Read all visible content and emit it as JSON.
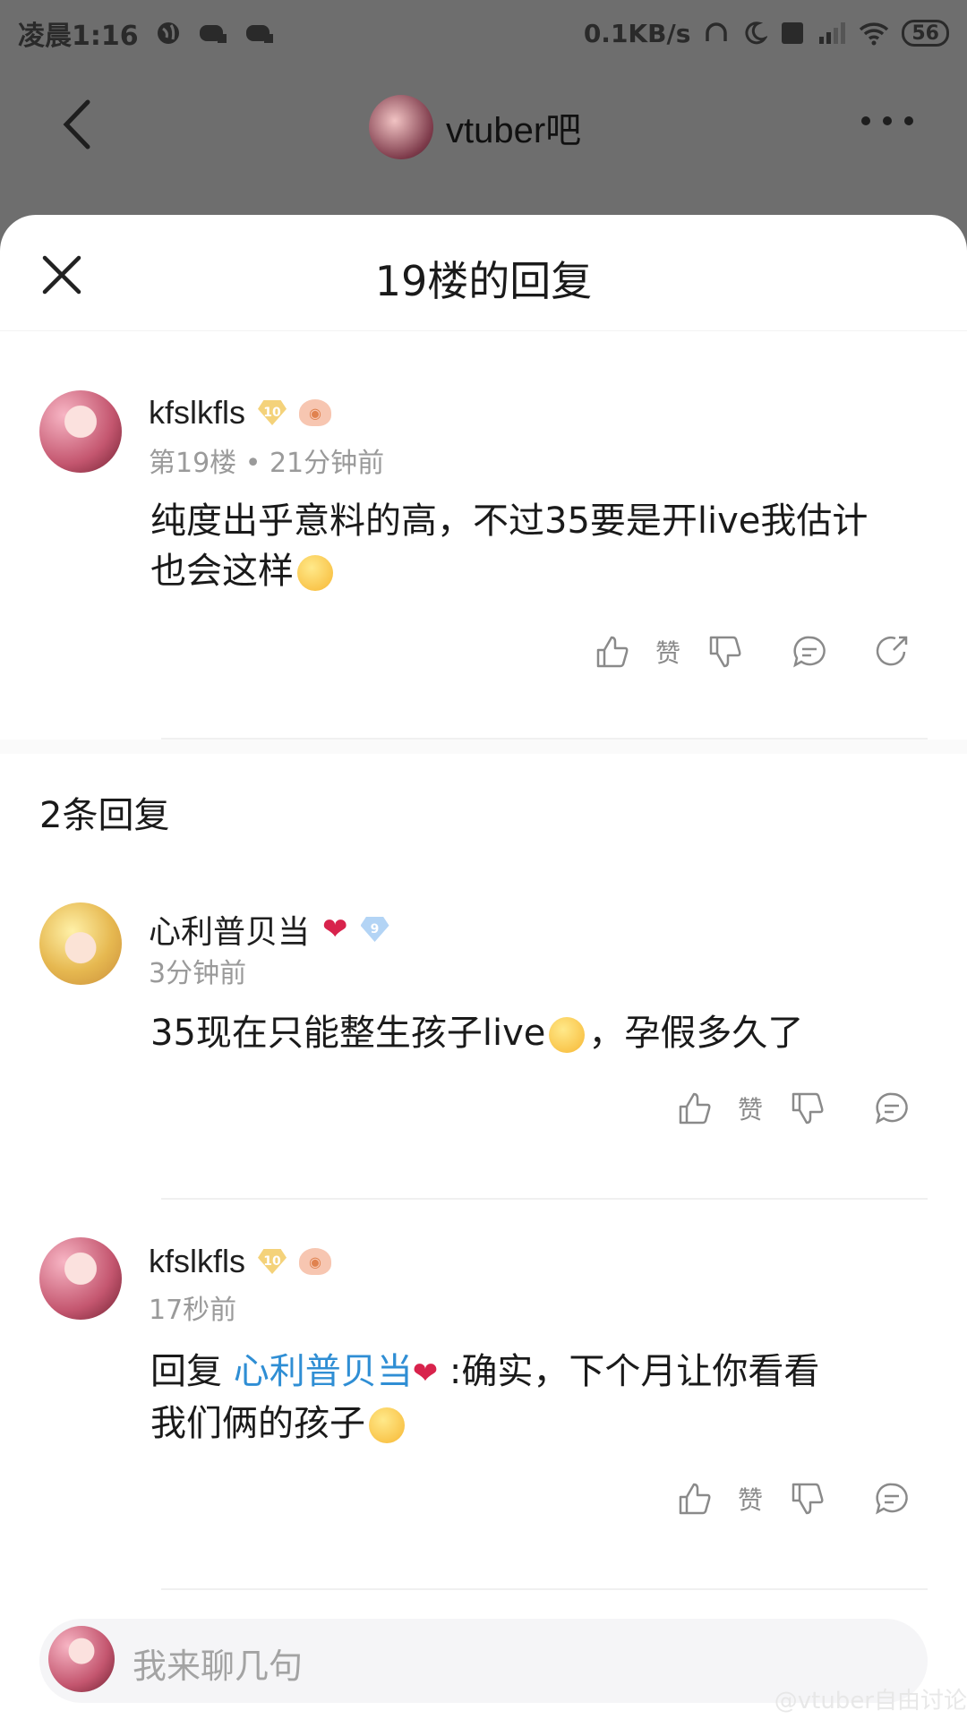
{
  "status_bar": {
    "time": "凌晨1:16",
    "net_speed": "0.1KB/s",
    "battery": "56"
  },
  "nav": {
    "forum_name": "vtuber吧"
  },
  "sheet": {
    "title": "19楼的回复"
  },
  "main_post": {
    "username": "kfslkfls",
    "level": "10",
    "meta": "第19楼 • 21分钟前",
    "content_line1": "纯度出乎意料的高，不过35要是开live我估计",
    "content_line2": "也会这样",
    "like_label": "赞"
  },
  "reply_count": "2条回复",
  "replies": [
    {
      "username": "心利普贝当",
      "level": "9",
      "time": "3分钟前",
      "content_a": "35现在只能整生孩子live",
      "content_b": "，孕假多久了",
      "like_label": "赞"
    },
    {
      "username": "kfslkfls",
      "level": "10",
      "time": "17秒前",
      "reply_prefix": "回复 ",
      "reply_target": "心利普贝当",
      "content_line1": " :确实，下个月让你看看",
      "content_line2": "我们俩的孩子",
      "like_label": "赞"
    }
  ],
  "input": {
    "placeholder": "我来聊几句"
  },
  "watermark": "@vtuber自由讨论"
}
